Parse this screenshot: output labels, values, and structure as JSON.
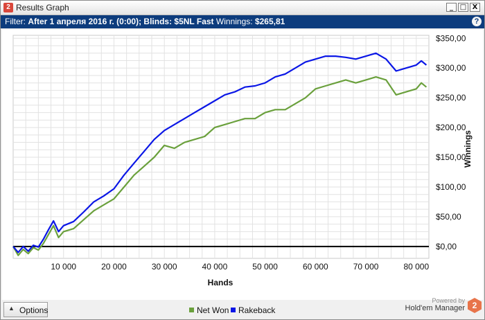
{
  "window": {
    "title": "Results Graph",
    "app_icon_text": "2",
    "buttons": [
      "_",
      "□",
      "X"
    ]
  },
  "filter": {
    "label": "Filter:",
    "date_value": "After 1 апреля 2016 г. (0:00);",
    "blinds_value": "Blinds: $5NL Fast",
    "winnings_label": "Winnings:",
    "winnings_value": "$265,81",
    "help_icon_text": "?"
  },
  "footer": {
    "options_label": "Options",
    "options_arrow": "▲",
    "powered_by": "Powered by",
    "brand_name": "Hold'em Manager",
    "brand_logo_text": "2"
  },
  "colors": {
    "net_won": "#6aa03c",
    "rakeback": "#0a16e6",
    "zero_line": "#000000",
    "grid": "#e2e2e2"
  },
  "chart_data": {
    "type": "line",
    "xlabel": "Hands",
    "ylabel": "Winnings",
    "xlim": [
      0,
      82500
    ],
    "ylim": [
      -20,
      355
    ],
    "x_ticks": [
      10000,
      20000,
      30000,
      40000,
      50000,
      60000,
      70000,
      80000
    ],
    "x_tick_labels": [
      "10 000",
      "20 000",
      "30 000",
      "40 000",
      "50 000",
      "60 000",
      "70 000",
      "80 000"
    ],
    "y_ticks": [
      0,
      50,
      100,
      150,
      200,
      250,
      300,
      350
    ],
    "y_tick_labels": [
      "$0,00",
      "$50,00",
      "$100,00",
      "$150,00",
      "$200,00",
      "$250,00",
      "$300,00",
      "$350,00"
    ],
    "grid": true,
    "legend_position": "bottom-center",
    "series": [
      {
        "name": "Net Won",
        "x": [
          0,
          1000,
          2000,
          3000,
          4000,
          5000,
          6000,
          7000,
          8000,
          9000,
          10000,
          12000,
          14000,
          16000,
          18000,
          20000,
          22000,
          24000,
          26000,
          28000,
          30000,
          32000,
          34000,
          36000,
          38000,
          40000,
          42000,
          44000,
          46000,
          48000,
          50000,
          52000,
          54000,
          56000,
          58000,
          60000,
          62000,
          64000,
          66000,
          68000,
          70000,
          72000,
          74000,
          76000,
          78000,
          80000,
          81000,
          82000
        ],
        "values": [
          0,
          -15,
          -5,
          -12,
          -2,
          -6,
          5,
          20,
          35,
          15,
          25,
          30,
          45,
          60,
          70,
          80,
          100,
          120,
          135,
          150,
          170,
          165,
          175,
          180,
          185,
          200,
          205,
          210,
          215,
          215,
          225,
          230,
          230,
          240,
          250,
          265,
          270,
          275,
          280,
          275,
          280,
          285,
          280,
          255,
          260,
          265,
          275,
          268
        ]
      },
      {
        "name": "Rakeback",
        "x": [
          0,
          1000,
          2000,
          3000,
          4000,
          5000,
          6000,
          7000,
          8000,
          9000,
          10000,
          12000,
          14000,
          16000,
          18000,
          20000,
          22000,
          24000,
          26000,
          28000,
          30000,
          32000,
          34000,
          36000,
          38000,
          40000,
          42000,
          44000,
          46000,
          48000,
          50000,
          52000,
          54000,
          56000,
          58000,
          60000,
          62000,
          64000,
          66000,
          68000,
          70000,
          72000,
          74000,
          76000,
          78000,
          80000,
          81000,
          82000
        ],
        "values": [
          0,
          -10,
          0,
          -8,
          2,
          -1,
          12,
          28,
          43,
          25,
          35,
          42,
          58,
          75,
          85,
          97,
          120,
          140,
          160,
          180,
          195,
          205,
          215,
          225,
          235,
          245,
          255,
          260,
          268,
          270,
          275,
          285,
          290,
          300,
          310,
          315,
          320,
          320,
          318,
          315,
          320,
          325,
          315,
          295,
          300,
          305,
          312,
          305
        ]
      }
    ]
  }
}
